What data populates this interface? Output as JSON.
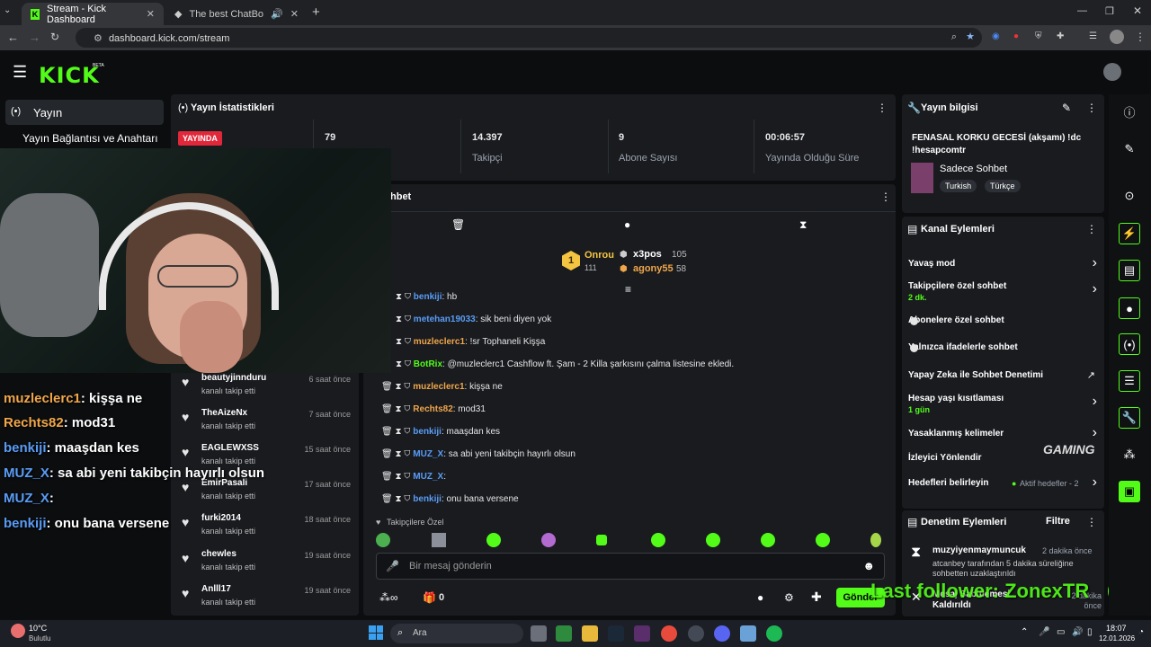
{
  "browser": {
    "tabs": [
      {
        "title": "Stream - Kick Dashboard"
      },
      {
        "title": "The best ChatBot and Widg"
      }
    ],
    "url": "dashboard.kick.com/stream"
  },
  "colors": {
    "accent": "#53fc18",
    "live": "#e0283a"
  },
  "sidebar": {
    "items": [
      {
        "label": "Yayın"
      },
      {
        "label": "Yayın Bağlantısı ve Anahtarı"
      }
    ]
  },
  "stats": {
    "title": "Yayın İstatistikleri",
    "live_badge": "YAYINDA",
    "viewers": "79",
    "followers_value": "14.397",
    "followers_label": "Takipçi",
    "subs_value": "9",
    "subs_label": "Abone Sayısı",
    "uptime_value": "00:06:57",
    "uptime_label": "Yayında Olduğu Süre"
  },
  "chat": {
    "title": "hbet",
    "leaderboard": {
      "first_name": "Onrou",
      "first_score": "111",
      "second_name": "x3pos",
      "second_score": "105",
      "third_name": "agony55",
      "third_score": "58"
    },
    "messages": [
      {
        "user": "benkiji",
        "text": ": hb"
      },
      {
        "user": "metehan19033",
        "text": ": sik beni diyen yok"
      },
      {
        "user": "muzleclerc1",
        "text": ": !sr Tophaneli Kişşa"
      },
      {
        "user": "BotRix",
        "text": ": @muzleclerc1 Cashflow ft. Şam - 2 Killa şarkısını çalma listesine ekledi."
      },
      {
        "user": "muzleclerc1",
        "text": ": kişşa ne"
      },
      {
        "user": "Rechts82",
        "text": ": mod31"
      },
      {
        "user": "benkiji",
        "text": ": maaşdan kes"
      },
      {
        "user": "MUZ_X",
        "text": ": sa abi yeni takibçin hayırlı olsun"
      },
      {
        "user": "MUZ_X",
        "text": ":"
      },
      {
        "user": "benkiji",
        "text": ": onu bana versene"
      }
    ],
    "followers_only": "Takipçilere Özel",
    "input_placeholder": "Bir mesaj gönderin",
    "points": "0",
    "send_label": "Gönder"
  },
  "recent_followers": [
    {
      "name": "beautyjinnduru",
      "sub": "kanalı takip etti",
      "time": "6 saat önce"
    },
    {
      "name": "TheAizeNx",
      "sub": "kanalı takip etti",
      "time": "7 saat önce"
    },
    {
      "name": "EAGLEWXSS",
      "sub": "kanalı takip etti",
      "time": "15 saat önce"
    },
    {
      "name": "EmirPasali",
      "sub": "kanalı takip etti",
      "time": "17 saat önce"
    },
    {
      "name": "furki2014",
      "sub": "kanalı takip etti",
      "time": "18 saat önce"
    },
    {
      "name": "chewles",
      "sub": "kanalı takip etti",
      "time": "19 saat önce"
    },
    {
      "name": "Anlll17",
      "sub": "kanalı takip etti",
      "time": "19 saat önce"
    }
  ],
  "overlay_chat": [
    {
      "user": "muzleclerc1",
      "text": ": kişşa ne"
    },
    {
      "user": "Rechts82",
      "text": ": mod31"
    },
    {
      "user": "benkiji",
      "text": ": maaşdan kes"
    },
    {
      "user": "MUZ_X",
      "text": ": sa abi yeni takibçin hayırlı olsun"
    },
    {
      "user": "MUZ_X",
      "text": ":"
    },
    {
      "user": "benkiji",
      "text": ": onu bana versene"
    }
  ],
  "stream_info": {
    "title": "Yayın bilgisi",
    "stream_title": "FENASAL KORKU GECESİ (akşamı) !dc !hesapcomtr",
    "category": "Sadece Sohbet",
    "tags": [
      "Turkish",
      "Türkçe"
    ]
  },
  "channel_actions": {
    "title": "Kanal Eylemleri",
    "items": [
      {
        "label": "Yavaş mod",
        "sub": ""
      },
      {
        "label": "Takipçilere özel sohbet",
        "sub": "2 dk."
      },
      {
        "label": "Abonelere özel sohbet",
        "sub": ""
      },
      {
        "label": "Yalnızca ifadelerle sohbet",
        "sub": ""
      },
      {
        "label": "Yapay Zeka ile Sohbet Denetimi",
        "sub": ""
      },
      {
        "label": "Hesap yaşı kısıtlaması",
        "sub": "1 gün"
      },
      {
        "label": "Yasaklanmış kelimeler",
        "sub": ""
      },
      {
        "label": "İzleyici Yönlendir",
        "sub": ""
      },
      {
        "label": "Hedefleri belirleyin",
        "sub": ""
      }
    ],
    "goals_status": "Aktif hedefler - 2"
  },
  "mod_actions": {
    "title": "Denetim Eylemleri",
    "filter": "Filtre",
    "entries": [
      {
        "user": "muzyiyenmaymuncuk",
        "time": "2 dakika önce",
        "detail": "atcanbey tarafından 5 dakika süreliğine sohbetten uzaklaştırıldı"
      },
      {
        "user": "Mesaj Sabitlemesi Kaldırıldı",
        "time": "2 dakika önce",
        "detail": ""
      }
    ]
  },
  "overlay_texts": {
    "last_follower": "Last follower: ZonexTR",
    "gaming_logo": "GAMING"
  },
  "taskbar": {
    "weather_temp": "10°C",
    "weather_desc": "Bulutlu",
    "search": "Ara",
    "time": "18:07",
    "date": "12.01.2026"
  }
}
